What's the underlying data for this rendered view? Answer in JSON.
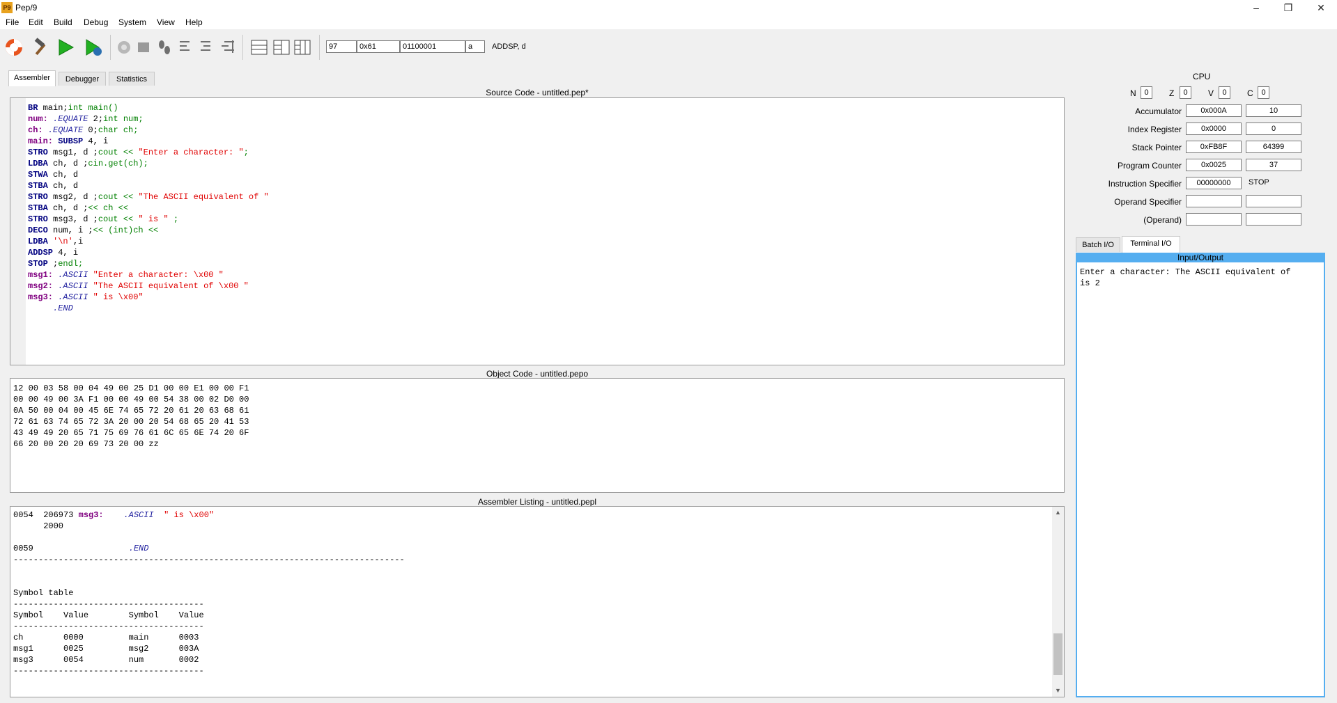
{
  "window": {
    "title": "Pep/9",
    "icon_text": "P9"
  },
  "menu": [
    "File",
    "Edit",
    "Build",
    "Debug",
    "System",
    "View",
    "Help"
  ],
  "toolbar": {
    "decimal_value": "97",
    "hex_value": "0x61",
    "binary_value": "01100001",
    "char_value": "a",
    "instruction": "ADDSP, d"
  },
  "tabs": [
    "Assembler",
    "Debugger",
    "Statistics"
  ],
  "source": {
    "title": "Source Code - untitled.pep*",
    "lines": [
      [
        [
          "kw",
          "BR"
        ],
        [
          "t",
          " main;"
        ],
        [
          "cmt",
          "int main()"
        ]
      ],
      [
        [
          "lbl",
          "num:"
        ],
        [
          "t",
          " "
        ],
        [
          "dir",
          ".EQUATE"
        ],
        [
          "t",
          " 2;"
        ],
        [
          "cmt",
          "int num;"
        ]
      ],
      [
        [
          "lbl",
          "ch:"
        ],
        [
          "t",
          " "
        ],
        [
          "dir",
          ".EQUATE"
        ],
        [
          "t",
          " 0;"
        ],
        [
          "cmt",
          "char ch;"
        ]
      ],
      [
        [
          "lbl",
          "main:"
        ],
        [
          "t",
          " "
        ],
        [
          "kw",
          "SUBSP"
        ],
        [
          "t",
          " 4, i"
        ]
      ],
      [
        [
          "kw",
          "STRO"
        ],
        [
          "t",
          " msg1, d ;"
        ],
        [
          "cmt",
          "cout << "
        ],
        [
          "str",
          "\"Enter a character: \""
        ],
        [
          "cmt",
          ";"
        ]
      ],
      [
        [
          "kw",
          "LDBA"
        ],
        [
          "t",
          " ch, d ;"
        ],
        [
          "cmt",
          "cin.get(ch);"
        ]
      ],
      [
        [
          "kw",
          "STWA"
        ],
        [
          "t",
          " ch, d"
        ]
      ],
      [
        [
          "kw",
          "STBA"
        ],
        [
          "t",
          " ch, d"
        ]
      ],
      [
        [
          "kw",
          "STRO"
        ],
        [
          "t",
          " msg2, d ;"
        ],
        [
          "cmt",
          "cout << "
        ],
        [
          "str",
          "\"The ASCII equivalent of \""
        ]
      ],
      [
        [
          "kw",
          "STBA"
        ],
        [
          "t",
          " ch, d ;"
        ],
        [
          "cmt",
          "<< ch <<"
        ]
      ],
      [
        [
          "kw",
          "STRO"
        ],
        [
          "t",
          " msg3, d ;"
        ],
        [
          "cmt",
          "cout << "
        ],
        [
          "str",
          "\" is \""
        ],
        [
          "cmt",
          " ;"
        ]
      ],
      [
        [
          "kw",
          "DECO"
        ],
        [
          "t",
          " num, i ;"
        ],
        [
          "cmt",
          "<< (int)ch <<"
        ]
      ],
      [
        [
          "kw",
          "LDBA"
        ],
        [
          "t",
          " "
        ],
        [
          "str",
          "'\\n'"
        ],
        [
          "t",
          ",i"
        ]
      ],
      [
        [
          "kw",
          "ADDSP"
        ],
        [
          "t",
          " 4, i"
        ]
      ],
      [
        [
          "kw",
          "STOP"
        ],
        [
          "t",
          " ;"
        ],
        [
          "cmt",
          "endl;"
        ]
      ],
      [
        [
          "lbl",
          "msg1:"
        ],
        [
          "t",
          " "
        ],
        [
          "dir",
          ".ASCII"
        ],
        [
          "t",
          " "
        ],
        [
          "str",
          "\"Enter a character: \\x00 \""
        ]
      ],
      [
        [
          "lbl",
          "msg2:"
        ],
        [
          "t",
          " "
        ],
        [
          "dir",
          ".ASCII"
        ],
        [
          "t",
          " "
        ],
        [
          "str",
          "\"The ASCII equivalent of \\x00 \""
        ]
      ],
      [
        [
          "lbl",
          "msg3:"
        ],
        [
          "t",
          " "
        ],
        [
          "dir",
          ".ASCII"
        ],
        [
          "t",
          " "
        ],
        [
          "str",
          "\" is \\x00\""
        ]
      ],
      [
        [
          "t",
          "     "
        ],
        [
          "dir",
          ".END"
        ]
      ]
    ]
  },
  "object": {
    "title": "Object Code - untitled.pepo",
    "lines": [
      "12 00 03 58 00 04 49 00 25 D1 00 00 E1 00 00 F1",
      "00 00 49 00 3A F1 00 00 49 00 54 38 00 02 D0 00",
      "0A 50 00 04 00 45 6E 74 65 72 20 61 20 63 68 61",
      "72 61 63 74 65 72 3A 20 00 20 54 68 65 20 41 53",
      "43 49 49 20 65 71 75 69 76 61 6C 65 6E 74 20 6F",
      "66 20 00 20 20 69 73 20 00 zz"
    ]
  },
  "listing": {
    "title": "Assembler Listing - untitled.pepl",
    "lines": [
      [
        [
          "t",
          "0054  206973 "
        ],
        [
          "lbl",
          "msg3:"
        ],
        [
          "t",
          "    "
        ],
        [
          "dir",
          ".ASCII"
        ],
        [
          "t",
          "  "
        ],
        [
          "str",
          "\" is \\x00\""
        ]
      ],
      [
        [
          "t",
          "      2000"
        ]
      ],
      [
        [
          "t",
          ""
        ]
      ],
      [
        [
          "t",
          "0059                   "
        ],
        [
          "dir",
          ".END"
        ]
      ],
      [
        [
          "t",
          "------------------------------------------------------------------------------"
        ]
      ],
      [
        [
          "t",
          ""
        ]
      ],
      [
        [
          "t",
          ""
        ]
      ],
      [
        [
          "t",
          "Symbol table"
        ]
      ],
      [
        [
          "t",
          "--------------------------------------"
        ]
      ],
      [
        [
          "t",
          "Symbol    Value        Symbol    Value"
        ]
      ],
      [
        [
          "t",
          "--------------------------------------"
        ]
      ],
      [
        [
          "t",
          "ch        0000         main      0003"
        ]
      ],
      [
        [
          "t",
          "msg1      0025         msg2      003A"
        ]
      ],
      [
        [
          "t",
          "msg3      0054         num       0002"
        ]
      ],
      [
        [
          "t",
          "--------------------------------------"
        ]
      ]
    ]
  },
  "cpu": {
    "title": "CPU",
    "flags": [
      {
        "name": "N",
        "value": "0"
      },
      {
        "name": "Z",
        "value": "0"
      },
      {
        "name": "V",
        "value": "0"
      },
      {
        "name": "C",
        "value": "0"
      }
    ],
    "registers": [
      {
        "label": "Accumulator",
        "hex": "0x000A",
        "dec": "10"
      },
      {
        "label": "Index Register",
        "hex": "0x0000",
        "dec": "0"
      },
      {
        "label": "Stack Pointer",
        "hex": "0xFB8F",
        "dec": "64399"
      },
      {
        "label": "Program Counter",
        "hex": "0x0025",
        "dec": "37"
      },
      {
        "label": "Instruction Specifier",
        "hex": "00000000",
        "dec": "STOP"
      },
      {
        "label": "Operand Specifier",
        "hex": "",
        "dec": ""
      },
      {
        "label": "(Operand)",
        "hex": "",
        "dec": ""
      }
    ]
  },
  "io": {
    "tabs": [
      "Batch I/O",
      "Terminal I/O"
    ],
    "header": "Input/Output",
    "text": "Enter a character: The ASCII equivalent of\nis 2"
  }
}
